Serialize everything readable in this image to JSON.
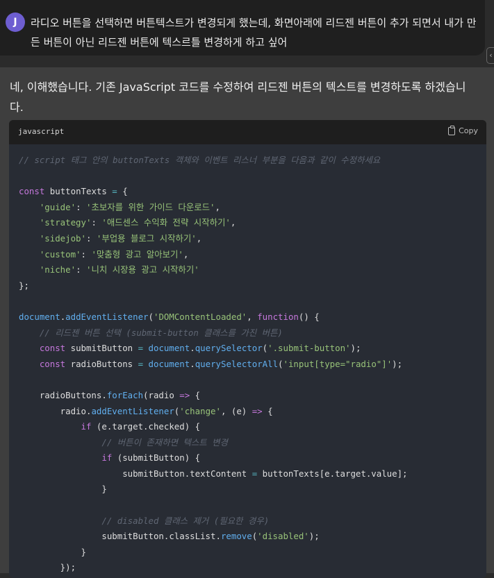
{
  "user_message": {
    "avatar_letter": "J",
    "text": "라디오 버튼을 선택하면 버튼텍스트가 변경되게 했는데, 화면아래에 리드젠 버튼이 추가 되면서 내가 만든 버튼이 아닌 리드젠 버튼에 텍스르틀 변경하게 하고 싶어"
  },
  "assistant_message": {
    "text": "네, 이해했습니다. 기존 JavaScript 코드를 수정하여 리드젠 버튼의 텍스트를 변경하도록 하겠습니다."
  },
  "code_block": {
    "language": "javascript",
    "copy_label": "Copy",
    "lines": [
      [
        [
          "c",
          "// script 태그 안의 buttonTexts 객체와 이벤트 리스너 부분을 다음과 같이 수정하세요"
        ]
      ],
      [],
      [
        [
          "k",
          "const"
        ],
        [
          "",
          " buttonTexts "
        ],
        [
          "o",
          "="
        ],
        [
          "",
          " {"
        ]
      ],
      [
        [
          "",
          "    "
        ],
        [
          "s",
          "'guide'"
        ],
        [
          "",
          ": "
        ],
        [
          "s",
          "'초보자를 위한 가이드 다운로드'"
        ],
        [
          "",
          ","
        ]
      ],
      [
        [
          "",
          "    "
        ],
        [
          "s",
          "'strategy'"
        ],
        [
          "",
          ": "
        ],
        [
          "s",
          "'애드센스 수익화 전략 시작하기'"
        ],
        [
          "",
          ","
        ]
      ],
      [
        [
          "",
          "    "
        ],
        [
          "s",
          "'sidejob'"
        ],
        [
          "",
          ": "
        ],
        [
          "s",
          "'부업용 블로그 시작하기'"
        ],
        [
          "",
          ","
        ]
      ],
      [
        [
          "",
          "    "
        ],
        [
          "s",
          "'custom'"
        ],
        [
          "",
          ": "
        ],
        [
          "s",
          "'맞춤형 광고 알아보기'"
        ],
        [
          "",
          ","
        ]
      ],
      [
        [
          "",
          "    "
        ],
        [
          "s",
          "'niche'"
        ],
        [
          "",
          ": "
        ],
        [
          "s",
          "'니치 시장용 광고 시작하기'"
        ]
      ],
      [
        [
          "",
          "};"
        ]
      ],
      [],
      [
        [
          "f",
          "document"
        ],
        [
          "",
          "."
        ],
        [
          "f",
          "addEventListener"
        ],
        [
          "",
          "("
        ],
        [
          "s",
          "'DOMContentLoaded'"
        ],
        [
          "",
          ", "
        ],
        [
          "k",
          "function"
        ],
        [
          "",
          "() {"
        ]
      ],
      [
        [
          "",
          "    "
        ],
        [
          "c",
          "// 리드젠 버튼 선택 (submit-button 클래스를 가진 버튼)"
        ]
      ],
      [
        [
          "",
          "    "
        ],
        [
          "k",
          "const"
        ],
        [
          "",
          " submitButton "
        ],
        [
          "o",
          "="
        ],
        [
          "",
          " "
        ],
        [
          "f",
          "document"
        ],
        [
          "",
          "."
        ],
        [
          "f",
          "querySelector"
        ],
        [
          "",
          "("
        ],
        [
          "s",
          "'.submit-button'"
        ],
        [
          "",
          ");"
        ]
      ],
      [
        [
          "",
          "    "
        ],
        [
          "k",
          "const"
        ],
        [
          "",
          " radioButtons "
        ],
        [
          "o",
          "="
        ],
        [
          "",
          " "
        ],
        [
          "f",
          "document"
        ],
        [
          "",
          "."
        ],
        [
          "f",
          "querySelectorAll"
        ],
        [
          "",
          "("
        ],
        [
          "s",
          "'input[type=\"radio\"]'"
        ],
        [
          "",
          ");"
        ]
      ],
      [],
      [
        [
          "",
          "    radioButtons."
        ],
        [
          "f",
          "forEach"
        ],
        [
          "",
          "(radio "
        ],
        [
          "k",
          "=>"
        ],
        [
          "",
          " {"
        ]
      ],
      [
        [
          "",
          "        radio."
        ],
        [
          "f",
          "addEventListener"
        ],
        [
          "",
          "("
        ],
        [
          "s",
          "'change'"
        ],
        [
          "",
          ", (e) "
        ],
        [
          "k",
          "=>"
        ],
        [
          "",
          " {"
        ]
      ],
      [
        [
          "",
          "            "
        ],
        [
          "k",
          "if"
        ],
        [
          "",
          " (e.target.checked) {"
        ]
      ],
      [
        [
          "",
          "                "
        ],
        [
          "c",
          "// 버튼이 존재하면 텍스트 변경"
        ]
      ],
      [
        [
          "",
          "                "
        ],
        [
          "k",
          "if"
        ],
        [
          "",
          " (submitButton) {"
        ]
      ],
      [
        [
          "",
          "                    submitButton.textContent "
        ],
        [
          "o",
          "="
        ],
        [
          "",
          " buttonTexts[e.target.value];"
        ]
      ],
      [
        [
          "",
          "                }"
        ]
      ],
      [],
      [
        [
          "",
          "                "
        ],
        [
          "c",
          "// disabled 클래스 제거 (필요한 경우)"
        ]
      ],
      [
        [
          "",
          "                submitButton.classList."
        ],
        [
          "f",
          "remove"
        ],
        [
          "",
          "("
        ],
        [
          "s",
          "'disabled'"
        ],
        [
          "",
          ");"
        ]
      ],
      [
        [
          "",
          "            }"
        ]
      ],
      [
        [
          "",
          "        });"
        ]
      ]
    ]
  }
}
